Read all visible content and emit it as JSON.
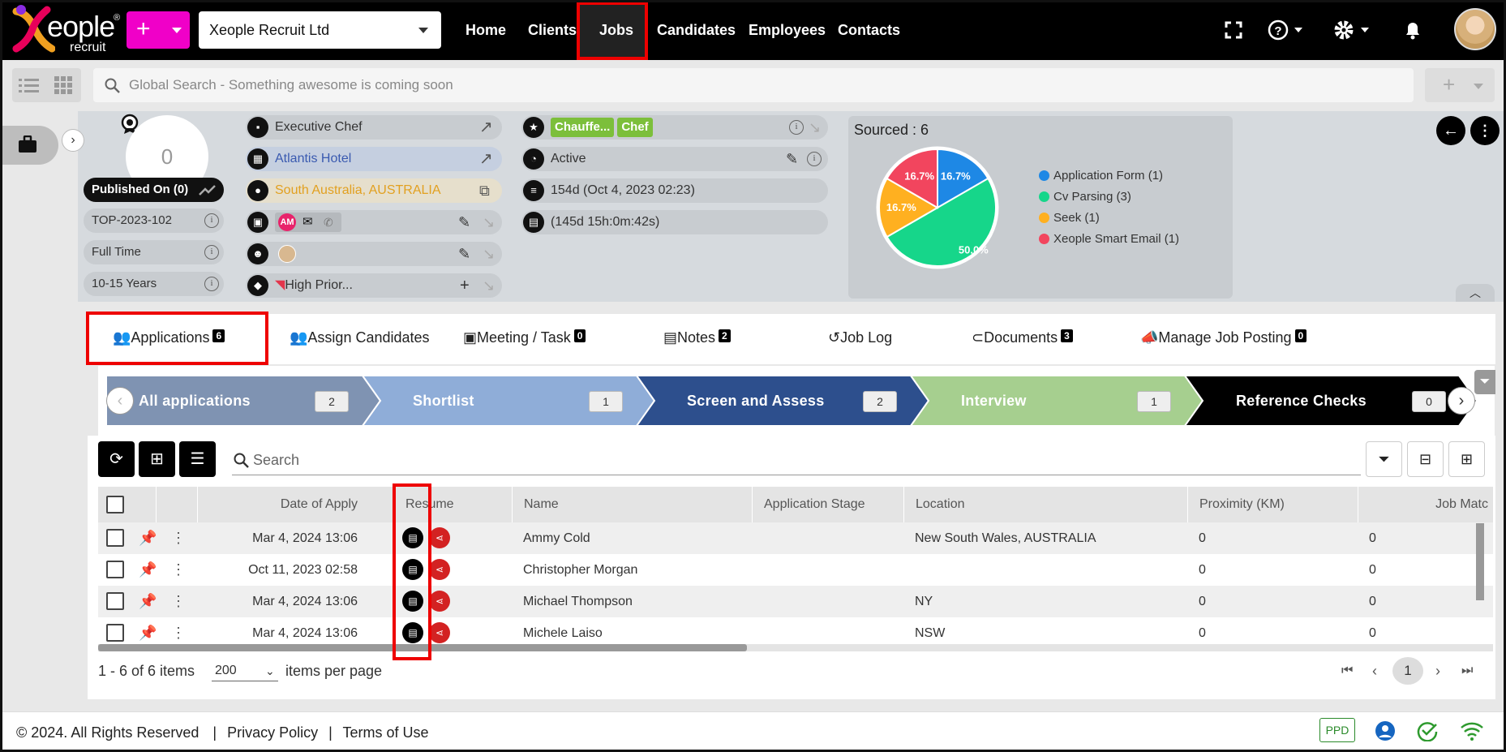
{
  "nav": {
    "brand_main": "eople",
    "brand_reg": "®",
    "brand_sub": "recruit",
    "plus_label": "+",
    "company": "Xeople Recruit Ltd",
    "links": [
      "Home",
      "Clients",
      "Jobs",
      "Candidates",
      "Employees",
      "Contacts"
    ],
    "active_link": "Jobs"
  },
  "search": {
    "placeholder": "Global Search - Something awesome is coming soon"
  },
  "job": {
    "score": "0",
    "published": "Published On (0)",
    "code": "TOP-2023-102",
    "type": "Full Time",
    "experience": "10-15 Years",
    "title": "Executive Chef",
    "client": "Atlantis Hotel",
    "location": "South Australia, AUSTRALIA",
    "owner_initials": "AM",
    "priority": "High Prior...",
    "tags": [
      "Chauffe...",
      "Chef"
    ],
    "status": "Active",
    "age": "154d (Oct 4, 2023 02:23)",
    "duration": "(145d 15h:0m:42s)"
  },
  "chart_data": {
    "type": "pie",
    "title": "Sourced : 6",
    "categories": [
      "Application Form (1)",
      "Cv Parsing (3)",
      "Seek (1)",
      "Xeople Smart Email (1)"
    ],
    "values": [
      1,
      3,
      1,
      1
    ],
    "labels": [
      "16.7%",
      "50.0%",
      "16.7%",
      "16.7%"
    ],
    "colors": [
      "#1e88e5",
      "#16d68a",
      "#ffb020",
      "#f2455e"
    ],
    "legend": "right"
  },
  "tabs": [
    {
      "label": "Applications",
      "count": "6"
    },
    {
      "label": "Assign Candidates",
      "count": ""
    },
    {
      "label": "Meeting / Task",
      "count": "0"
    },
    {
      "label": "Notes",
      "count": "2"
    },
    {
      "label": "Job Log",
      "count": ""
    },
    {
      "label": "Documents",
      "count": "3"
    },
    {
      "label": "Manage Job Posting",
      "count": "0"
    }
  ],
  "stages": [
    {
      "label": "All applications",
      "count": "2",
      "color": "#7f93b2"
    },
    {
      "label": "Shortlist",
      "count": "1",
      "color": "#8fadd8"
    },
    {
      "label": "Screen and Assess",
      "count": "2",
      "color": "#2d4f8d"
    },
    {
      "label": "Interview",
      "count": "1",
      "color": "#a6cf8f"
    },
    {
      "label": "Reference Checks",
      "count": "0",
      "color": "#000000"
    }
  ],
  "table": {
    "search_placeholder": "Search",
    "columns": [
      "Date of Apply",
      "Resume",
      "Name",
      "Application Stage",
      "Location",
      "Proximity (KM)",
      "Job Matc"
    ],
    "rows": [
      {
        "date": "Mar 4, 2024 13:06",
        "name": "Ammy Cold",
        "stage": "",
        "location": "New South Wales, AUSTRALIA",
        "proximity": "0",
        "match": "0"
      },
      {
        "date": "Oct 11, 2023 02:58",
        "name": "Christopher Morgan",
        "stage": "",
        "location": "",
        "proximity": "0",
        "match": "0"
      },
      {
        "date": "Mar 4, 2024 13:06",
        "name": "Michael Thompson",
        "stage": "",
        "location": "NY",
        "proximity": "0",
        "match": "0"
      },
      {
        "date": "Mar 4, 2024 13:06",
        "name": "Michele Laiso",
        "stage": "",
        "location": "NSW",
        "proximity": "0",
        "match": "0"
      }
    ]
  },
  "pager": {
    "summary": "1 - 6 of 6 items",
    "per_page": "200",
    "per_page_label": "items per page",
    "page": "1"
  },
  "footer": {
    "copyright": "© 2024. All Rights Reserved",
    "sep": "|",
    "privacy": "Privacy Policy",
    "terms": "Terms of Use",
    "ppd": "PPD"
  }
}
